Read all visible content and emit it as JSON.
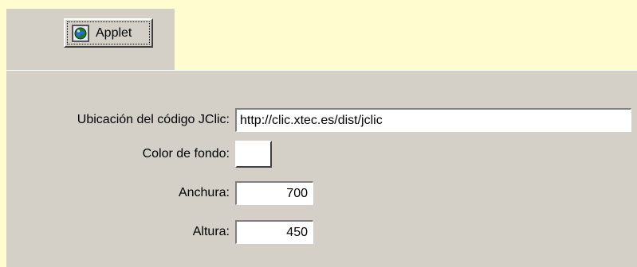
{
  "toolbar": {
    "applet_label": "Applet",
    "applet_icon": "globe-icon"
  },
  "form": {
    "codebase": {
      "label": "Ubicación del código JClic:",
      "value": "http://clic.xtec.es/dist/jclic"
    },
    "bgcolor": {
      "label": "Color de fondo:",
      "value": "#ffffff"
    },
    "width": {
      "label": "Anchura:",
      "value": "700"
    },
    "height": {
      "label": "Altura:",
      "value": "450"
    }
  },
  "colors": {
    "page_background": "#fffcd0",
    "panel_background": "#d4d0c8"
  }
}
